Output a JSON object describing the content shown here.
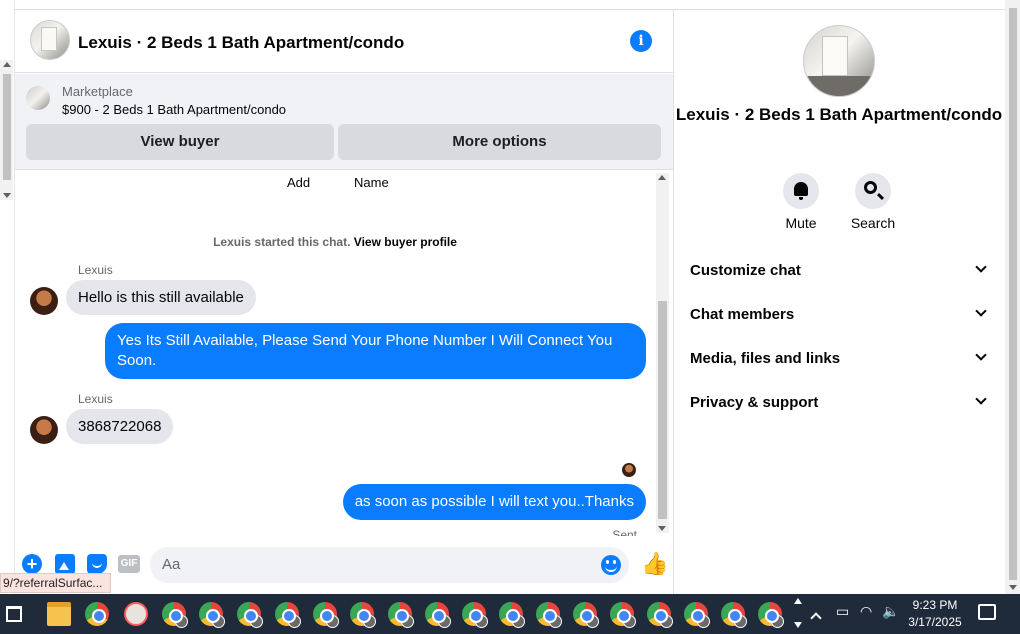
{
  "header": {
    "title": "Lexuis · 2 Beds 1 Bath Apartment/condo"
  },
  "listing": {
    "source": "Marketplace",
    "description": "$900 - 2 Beds 1 Bath Apartment/condo",
    "view_buyer_label": "View buyer",
    "more_options_label": "More options"
  },
  "thread": {
    "partial_labels": [
      "Add",
      "Name"
    ],
    "started_text": "Lexuis started this chat.",
    "started_link": "View buyer profile",
    "messages": [
      {
        "from": "Lexuis",
        "direction": "in",
        "text": "Hello is this still available"
      },
      {
        "direction": "out",
        "text": "Yes Its Still Available, Please Send Your Phone Number I Will Connect You Soon."
      },
      {
        "from": "Lexuis",
        "direction": "in",
        "text": "3868722068"
      },
      {
        "direction": "out",
        "text": "as soon as possible I will text you..Thanks"
      }
    ],
    "status": "Sent"
  },
  "composer": {
    "placeholder": "Aa",
    "gif_label": "GIF"
  },
  "url_tooltip": "9/?referralSurfac...",
  "details": {
    "title": "Lexuis · 2 Beds 1 Bath Apartment/condo",
    "actions": [
      {
        "label": "Mute",
        "icon": "bell-icon"
      },
      {
        "label": "Search",
        "icon": "search-icon"
      }
    ],
    "sections": [
      "Customize chat",
      "Chat members",
      "Media, files and links",
      "Privacy & support"
    ]
  },
  "taskbar": {
    "time": "9:23 PM",
    "date": "3/17/2025"
  },
  "colors": {
    "accent": "#0a7cff",
    "incoming_bubble": "#e4e6eb",
    "taskbar": "#1f2a3a"
  }
}
